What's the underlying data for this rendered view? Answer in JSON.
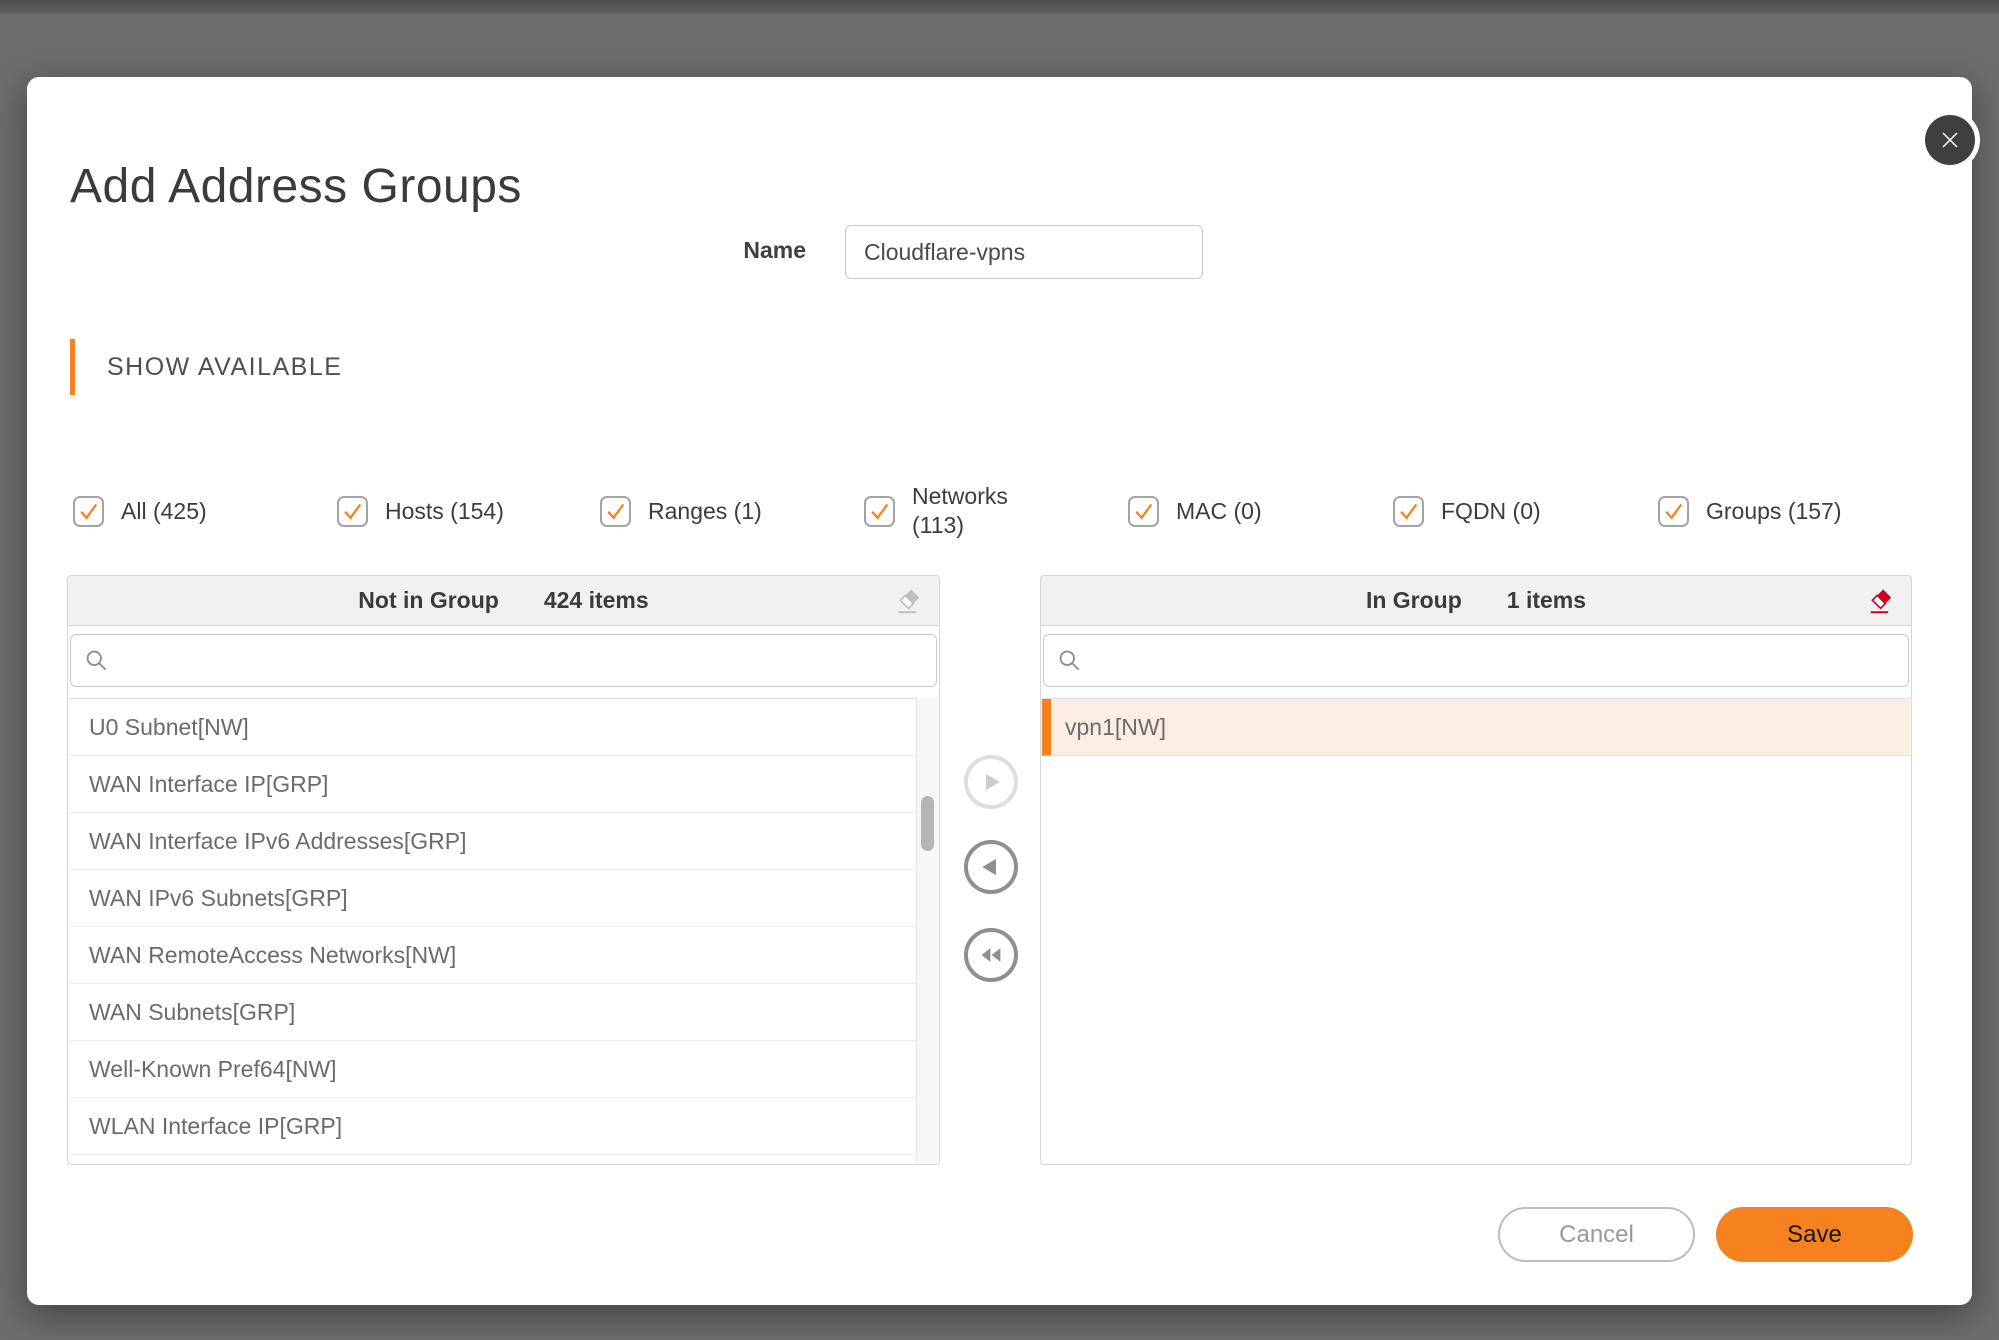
{
  "modal": {
    "title": "Add Address Groups"
  },
  "name_field": {
    "label": "Name",
    "value": "Cloudflare-vpns"
  },
  "section": {
    "title": "SHOW AVAILABLE"
  },
  "filters": [
    {
      "label": "All (425)",
      "checked": true
    },
    {
      "label": "Hosts (154)",
      "checked": true
    },
    {
      "label": "Ranges (1)",
      "checked": true
    },
    {
      "label": "Networks (113)",
      "checked": true
    },
    {
      "label": "MAC (0)",
      "checked": true
    },
    {
      "label": "FQDN (0)",
      "checked": true
    },
    {
      "label": "Groups (157)",
      "checked": true
    }
  ],
  "left_panel": {
    "title": "Not in Group",
    "count": "424 items",
    "search_placeholder": "",
    "items": [
      "U0 Subnet[NW]",
      "WAN Interface IP[GRP]",
      "WAN Interface IPv6 Addresses[GRP]",
      "WAN IPv6 Subnets[GRP]",
      "WAN RemoteAccess Networks[NW]",
      "WAN Subnets[GRP]",
      "Well-Known Pref64[NW]",
      "WLAN Interface IP[GRP]"
    ]
  },
  "right_panel": {
    "title": "In Group",
    "count": "1 items",
    "search_placeholder": "",
    "items": [
      "vpn1[NW]"
    ]
  },
  "actions": {
    "cancel": "Cancel",
    "save": "Save"
  },
  "colors": {
    "accent": "#F6821F",
    "eraser_active": "#D0021B",
    "eraser_disabled": "#BFBFBF",
    "selected_row_bg": "#FBEDE1",
    "overlay": "#6C6C6C"
  }
}
